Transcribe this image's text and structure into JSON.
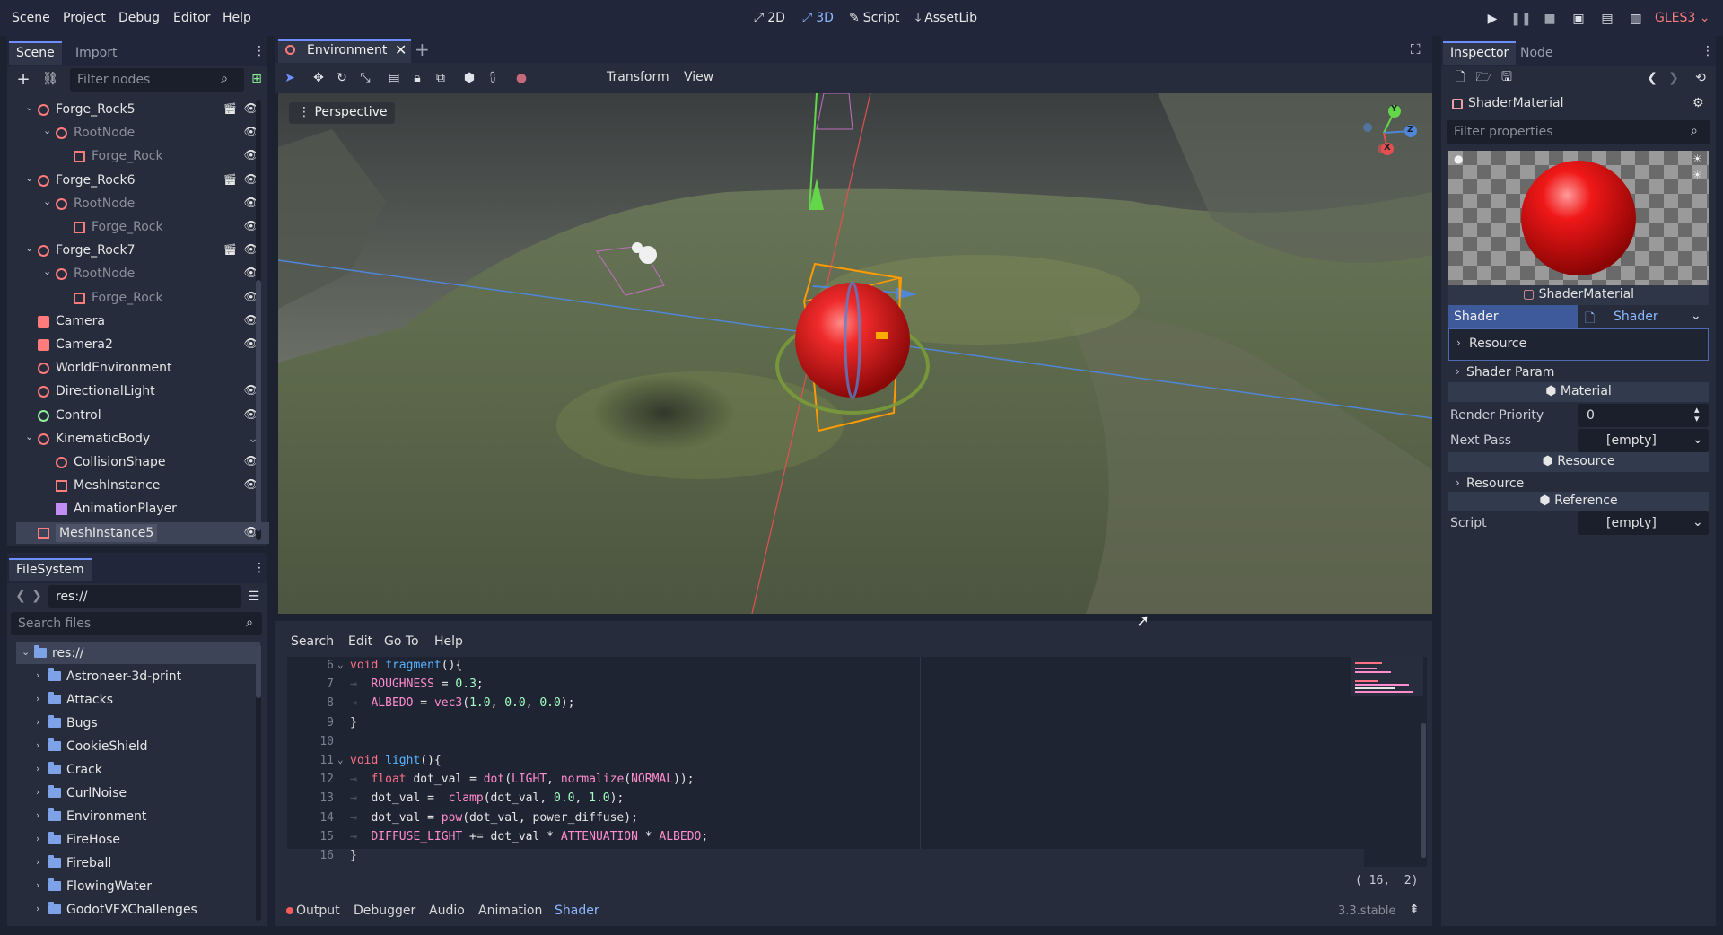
{
  "menu": [
    "Scene",
    "Project",
    "Debug",
    "Editor",
    "Help"
  ],
  "modes": [
    {
      "label": "2D",
      "icon": "2d-icon"
    },
    {
      "label": "3D",
      "icon": "3d-icon"
    },
    {
      "label": "Script",
      "icon": "script-icon"
    },
    {
      "label": "AssetLib",
      "icon": "assetlib-icon"
    }
  ],
  "renderer": "GLES3",
  "scene_dock": {
    "tabs": [
      "Scene",
      "Import"
    ],
    "filter_placeholder": "Filter nodes",
    "nodes": [
      {
        "label": "Forge_Rock5",
        "depth": 1,
        "arrow": "⌄",
        "icon": "node3d",
        "eye": true,
        "extra": true,
        "dim": false
      },
      {
        "label": "RootNode",
        "depth": 2,
        "arrow": "⌄",
        "icon": "node3d",
        "eye": true,
        "extra": false,
        "dim": true
      },
      {
        "label": "Forge_Rock",
        "depth": 3,
        "arrow": "",
        "icon": "mesh",
        "eye": true,
        "extra": false,
        "dim": true
      },
      {
        "label": "Forge_Rock6",
        "depth": 1,
        "arrow": "⌄",
        "icon": "node3d",
        "eye": true,
        "extra": true,
        "dim": false
      },
      {
        "label": "RootNode",
        "depth": 2,
        "arrow": "⌄",
        "icon": "node3d",
        "eye": true,
        "extra": false,
        "dim": true
      },
      {
        "label": "Forge_Rock",
        "depth": 3,
        "arrow": "",
        "icon": "mesh",
        "eye": true,
        "extra": false,
        "dim": true
      },
      {
        "label": "Forge_Rock7",
        "depth": 1,
        "arrow": "⌄",
        "icon": "node3d",
        "eye": true,
        "extra": true,
        "dim": false
      },
      {
        "label": "RootNode",
        "depth": 2,
        "arrow": "⌄",
        "icon": "node3d",
        "eye": true,
        "extra": false,
        "dim": true
      },
      {
        "label": "Forge_Rock",
        "depth": 3,
        "arrow": "",
        "icon": "mesh",
        "eye": true,
        "extra": false,
        "dim": true
      },
      {
        "label": "Camera",
        "depth": 1,
        "arrow": "",
        "icon": "camera",
        "eye": true,
        "extra": false,
        "dim": false
      },
      {
        "label": "Camera2",
        "depth": 1,
        "arrow": "",
        "icon": "camera",
        "eye": true,
        "extra": false,
        "dim": false
      },
      {
        "label": "WorldEnvironment",
        "depth": 1,
        "arrow": "",
        "icon": "world",
        "eye": false,
        "extra": false,
        "dim": false
      },
      {
        "label": "DirectionalLight",
        "depth": 1,
        "arrow": "",
        "icon": "light",
        "eye": true,
        "extra": false,
        "dim": false
      },
      {
        "label": "Control",
        "depth": 1,
        "arrow": "",
        "icon": "control",
        "eye": true,
        "extra": false,
        "dim": false
      },
      {
        "label": "KinematicBody",
        "depth": 1,
        "arrow": "⌄",
        "icon": "body",
        "eye": false,
        "extra": false,
        "dim": false,
        "fold": true
      },
      {
        "label": "CollisionShape",
        "depth": 2,
        "arrow": "",
        "icon": "shape",
        "eye": true,
        "extra": false,
        "dim": false
      },
      {
        "label": "MeshInstance",
        "depth": 2,
        "arrow": "",
        "icon": "mesh",
        "eye": true,
        "extra": false,
        "dim": false
      },
      {
        "label": "AnimationPlayer",
        "depth": 2,
        "arrow": "",
        "icon": "anim",
        "eye": false,
        "extra": false,
        "dim": false
      },
      {
        "label": "MeshInstance5",
        "depth": 1,
        "arrow": "",
        "icon": "mesh",
        "eye": true,
        "extra": false,
        "dim": false,
        "selected": true
      }
    ]
  },
  "filesystem": {
    "tab": "FileSystem",
    "path": "res://",
    "search_placeholder": "Search files",
    "items": [
      "res://",
      "Astroneer-3d-print",
      "Attacks",
      "Bugs",
      "CookieShield",
      "Crack",
      "CurlNoise",
      "Environment",
      "FireHose",
      "Fireball",
      "FlowingWater",
      "GodotVFXChallenges"
    ]
  },
  "editor_tab": "Environment",
  "viewport": {
    "toolbar": [
      "Transform",
      "View"
    ],
    "perspective": "Perspective",
    "gizmo_axes": [
      "Y",
      "Z",
      "X"
    ]
  },
  "shader_editor": {
    "menu": [
      "Search",
      "Edit",
      "Go To",
      "Help"
    ],
    "cursor": "( 16,  2)",
    "lines": [
      {
        "n": "6",
        "fold": true,
        "html": "<span class='kw'>void</span> <span class='fn'>fragment</span>(){"
      },
      {
        "n": "7",
        "fold": false,
        "html": "\t<span class='bi'>ROUGHNESS</span> = <span class='num'>0.3</span>;"
      },
      {
        "n": "8",
        "fold": false,
        "html": "\t<span class='bi'>ALBEDO</span> = <span class='builtin-fn'>vec3</span>(<span class='num'>1.0</span>, <span class='num'>0.0</span>, <span class='num'>0.0</span>);"
      },
      {
        "n": "9",
        "fold": false,
        "html": "}"
      },
      {
        "n": "10",
        "fold": false,
        "html": ""
      },
      {
        "n": "11",
        "fold": true,
        "html": "<span class='kw'>void</span> <span class='fn'>light</span>(){"
      },
      {
        "n": "12",
        "fold": false,
        "html": "\t<span class='kw'>float</span> dot_val = <span class='builtin-fn'>dot</span>(<span class='bi'>LIGHT</span>, <span class='builtin-fn'>normalize</span>(<span class='bi'>NORMAL</span>));"
      },
      {
        "n": "13",
        "fold": false,
        "html": "\tdot_val =  <span class='builtin-fn'>clamp</span>(dot_val, <span class='num'>0.0</span>, <span class='num'>1.0</span>);"
      },
      {
        "n": "14",
        "fold": false,
        "html": "\tdot_val = <span class='builtin-fn'>pow</span>(dot_val, power_diffuse);"
      },
      {
        "n": "15",
        "fold": false,
        "html": "\t<span class='bi'>DIFFUSE_LIGHT</span> += dot_val * <span class='bi'>ATTENUATION</span> * <span class='bi'>ALBEDO</span>;"
      },
      {
        "n": "16",
        "fold": false,
        "html": "}"
      }
    ]
  },
  "bottom_tabs": [
    "Output",
    "Debugger",
    "Audio",
    "Animation",
    "Shader"
  ],
  "version": "3.3.stable",
  "inspector": {
    "tabs": [
      "Inspector",
      "Node"
    ],
    "resource_name": "ShaderMaterial",
    "filter_placeholder": "Filter properties",
    "preview_label": "ShaderMaterial",
    "shader_label": "Shader",
    "shader_value": "Shader",
    "resource_group": "Resource",
    "shader_param": "Shader Param",
    "material_section": "Material",
    "render_priority_label": "Render Priority",
    "render_priority_value": "0",
    "next_pass_label": "Next Pass",
    "next_pass_value": "[empty]",
    "resource_section": "Resource",
    "resource_label": "Resource",
    "reference_section": "Reference",
    "script_label": "Script",
    "script_value": "[empty]"
  },
  "colors": {
    "accent": "#6e8eff",
    "sphere": "#e01010",
    "selection": "#ff9a00"
  }
}
